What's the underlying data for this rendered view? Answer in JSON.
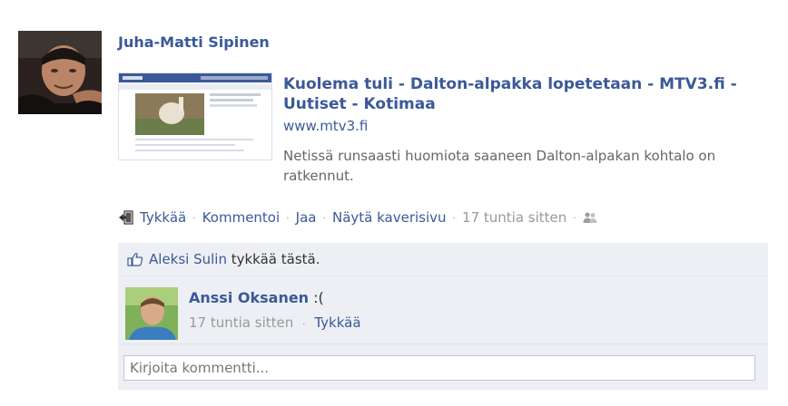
{
  "story": {
    "author": "Juha-Matti Sipinen",
    "attachment": {
      "title": "Kuolema tuli - Dalton-alpakka lopetetaan - MTV3.fi - Uutiset - Kotimaa",
      "domain": "www.mtv3.fi",
      "description": "Netissä runsaasti huomiota saaneen Dalton-alpakan kohtalo on ratkennut."
    },
    "actions": {
      "like": "Tykkää",
      "comment": "Kommentoi",
      "share": "Jaa",
      "friendship": "Näytä kaverisivu",
      "timestamp": "17 tuntia sitten",
      "separator": "·"
    }
  },
  "likes": {
    "name": "Aleksi Sulin",
    "text": " tykkää tästä."
  },
  "comments": [
    {
      "author": "Anssi Oksanen",
      "text": " :(",
      "timestamp": "17 tuntia sitten",
      "like_label": "Tykkää"
    }
  ],
  "comment_input": {
    "placeholder": "Kirjoita kommentti..."
  },
  "colors": {
    "link": "#3b5998",
    "muted": "#999999",
    "feedback_bg": "#edeff4"
  },
  "icons": {
    "share": "share-icon",
    "privacy": "friends-icon",
    "like": "thumbs-up-icon"
  }
}
